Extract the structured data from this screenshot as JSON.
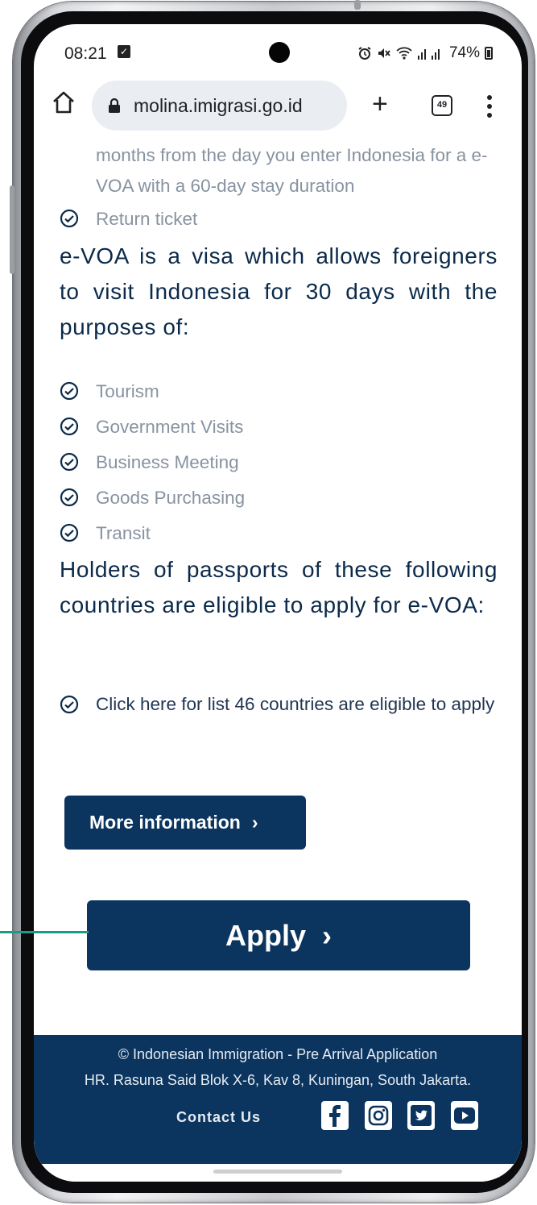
{
  "status_bar": {
    "time": "08:21",
    "battery": "74%"
  },
  "browser": {
    "url": "molina.imigrasi.go.id",
    "tab_count": "49"
  },
  "content": {
    "cut_text": "months from the day you enter Indonesia for a e-VOA with a 60-day stay duration",
    "requirement_item": "Return ticket",
    "heading_purpose": "e-VOA is a visa which allows foreigners to visit Indonesia for 30 days with the purposes of:",
    "purposes": [
      "Tourism",
      "Government Visits",
      "Business Meeting",
      "Goods Purchasing",
      "Transit"
    ],
    "heading_eligible": "Holders of passports of these following countries are eligible to apply for e-VOA:",
    "eligible_link": "Click here for list 46 countries are eligible to apply",
    "more_info_label": "More information",
    "apply_label": "Apply"
  },
  "footer": {
    "copyright": "© Indonesian Immigration - Pre Arrival Application",
    "address": "HR. Rasuna Said Blok X-6, Kav 8, Kuningan, South Jakarta.",
    "contact_label": "Contact Us",
    "social_icons": [
      "facebook-icon",
      "instagram-icon",
      "twitter-icon",
      "youtube-icon"
    ]
  },
  "colors": {
    "brand_navy": "#0b355e",
    "muted_text": "#8793a1",
    "callout": "#169c87"
  }
}
